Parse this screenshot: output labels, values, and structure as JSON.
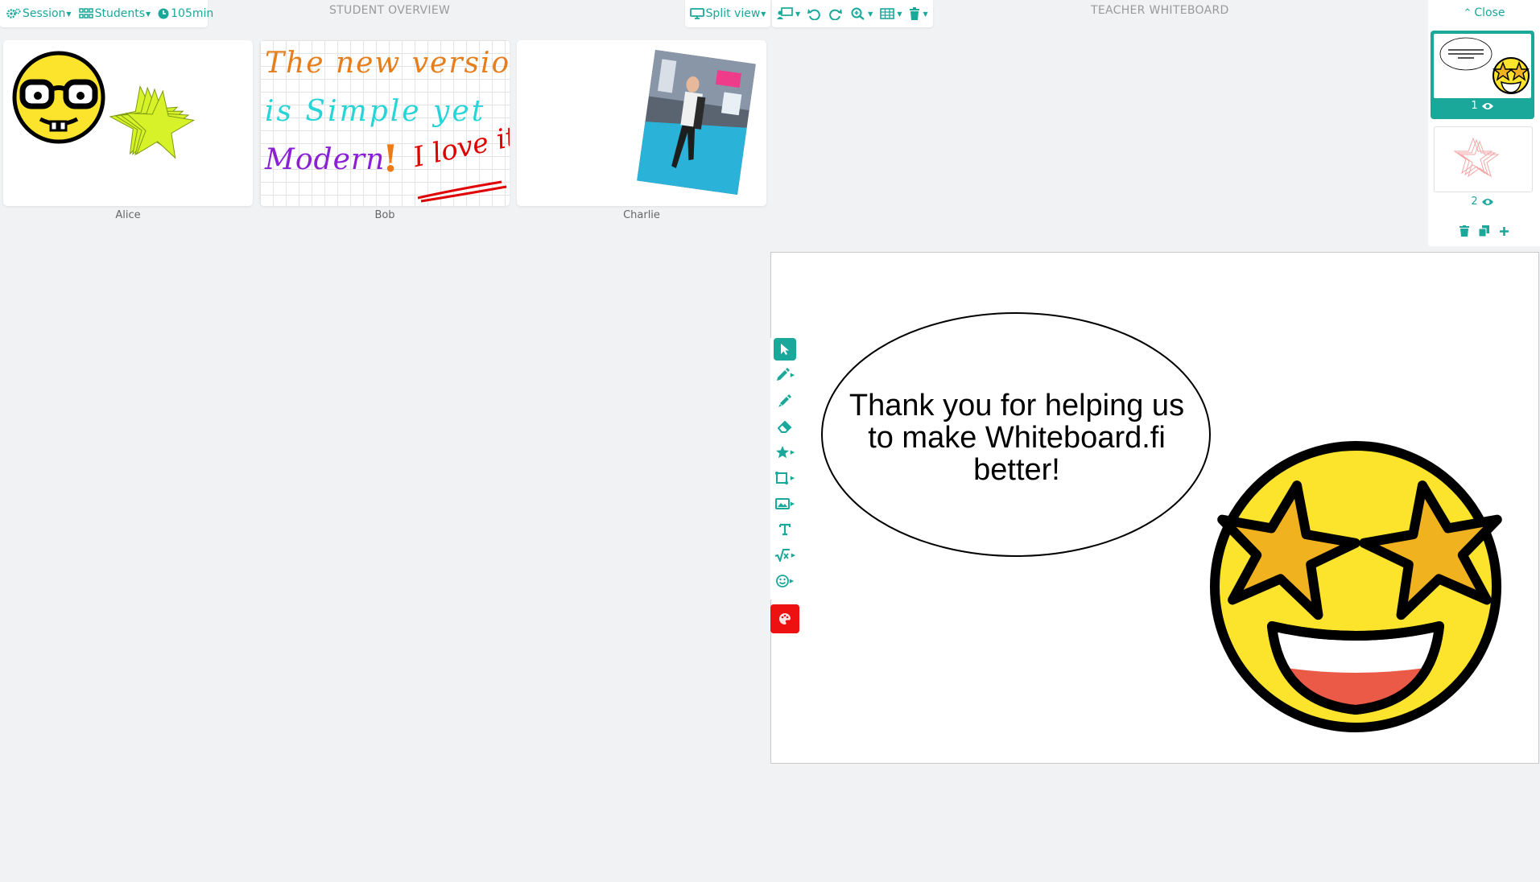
{
  "toolbar": {
    "session_label": "Session",
    "students_label": "Students",
    "timer_label": "105min",
    "split_view_label": "Split view"
  },
  "sections": {
    "student_overview": "STUDENT OVERVIEW",
    "teacher_whiteboard": "TEACHER WHITEBOARD"
  },
  "students": [
    {
      "name": "Alice"
    },
    {
      "name": "Bob"
    },
    {
      "name": "Charlie"
    }
  ],
  "bob_board": {
    "line1": "The new version",
    "line2": "is Simple yet",
    "line3": "Modern",
    "exclaim": "!",
    "love": "I love it!"
  },
  "whiteboard": {
    "bubble_text": "Thank you for helping us to make Whiteboard.fi better!"
  },
  "pages": {
    "close_label": "Close",
    "items": [
      {
        "number": "1",
        "active": true
      },
      {
        "number": "2",
        "active": false
      }
    ]
  },
  "colors": {
    "accent": "#1aa89a",
    "pen_color": "#ee1111",
    "emoji_yellow": "#fce42c",
    "star_gold": "#f0b21f"
  },
  "icons": {
    "tools": [
      "select-arrow-icon",
      "pencil-icon",
      "highlighter-icon",
      "eraser-icon",
      "star-shape-icon",
      "shapes-icon",
      "image-icon",
      "text-icon",
      "math-icon",
      "emoji-icon"
    ]
  }
}
